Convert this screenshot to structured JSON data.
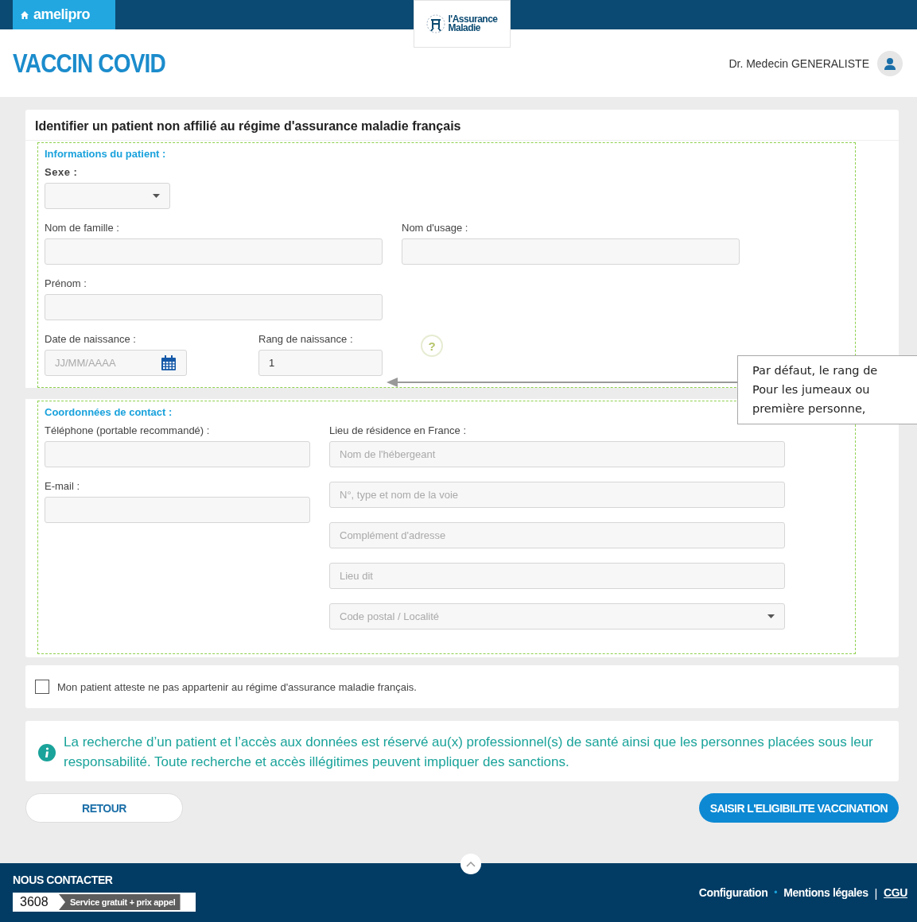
{
  "header": {
    "app_name": "amelipro",
    "logo_lines": [
      "l'Assurance",
      "Maladie"
    ],
    "page_title": "VACCIN COVID",
    "user_name": "Dr. Medecin GENERALISTE"
  },
  "form": {
    "title": "Identifier un patient non affilié au régime d'assurance maladie français",
    "patient_section": {
      "title": "Informations du patient :",
      "sex": {
        "label": "Sexe :"
      },
      "last_name": {
        "label": "Nom de famille :"
      },
      "usage_name": {
        "label": "Nom d'usage :"
      },
      "first_name": {
        "label": "Prénom :"
      },
      "birth_date": {
        "label": "Date de naissance :",
        "placeholder": "JJ/MM/AAAA"
      },
      "birth_rank": {
        "label": "Rang de naissance :",
        "value": "1"
      },
      "help": "?"
    },
    "contact_section": {
      "title": "Coordonnées de contact :",
      "left_fields": [
        {
          "label": "Téléphone (portable recommandé) :"
        },
        {
          "label": "E-mail :"
        }
      ],
      "address": {
        "label": "Lieu de résidence en France :",
        "fields": [
          {
            "kind": "text",
            "placeholder": "Nom de l'hébergeant"
          },
          {
            "kind": "text",
            "placeholder": "N°, type et nom de la voie"
          },
          {
            "kind": "text",
            "placeholder": "Complément d'adresse"
          },
          {
            "kind": "text",
            "placeholder": "Lieu dit"
          },
          {
            "kind": "select",
            "placeholder": "Code postal / Localité"
          }
        ]
      }
    },
    "attestation": {
      "label": "Mon patient atteste ne pas appartenir au régime d'assurance maladie français.",
      "checked": false
    }
  },
  "notice": "La recherche d’un patient et l’accès aux données est réservé au(x) professionnel(s) de santé ainsi que les personnes placées sous leur responsabilité. Toute recherche et accès illégitimes peuvent impliquer des sanctions.",
  "buttons": {
    "back": "RETOUR",
    "submit": "SAISIR L'ELIGIBILITE VACCINATION"
  },
  "callout": {
    "lines": [
      "Par défaut, le rang de",
      "Pour les jumeaux ou",
      "première personne,"
    ]
  },
  "footer": {
    "contact_title": "NOUS CONTACTER",
    "phone": "3608",
    "phone_note": "Service gratuit + prix appel",
    "links": [
      {
        "label": "Configuration",
        "underlined": false
      },
      {
        "label": "Mentions légales",
        "underlined": false
      },
      {
        "label": "CGU",
        "underlined": true
      }
    ],
    "separators": [
      "•",
      "|"
    ]
  }
}
